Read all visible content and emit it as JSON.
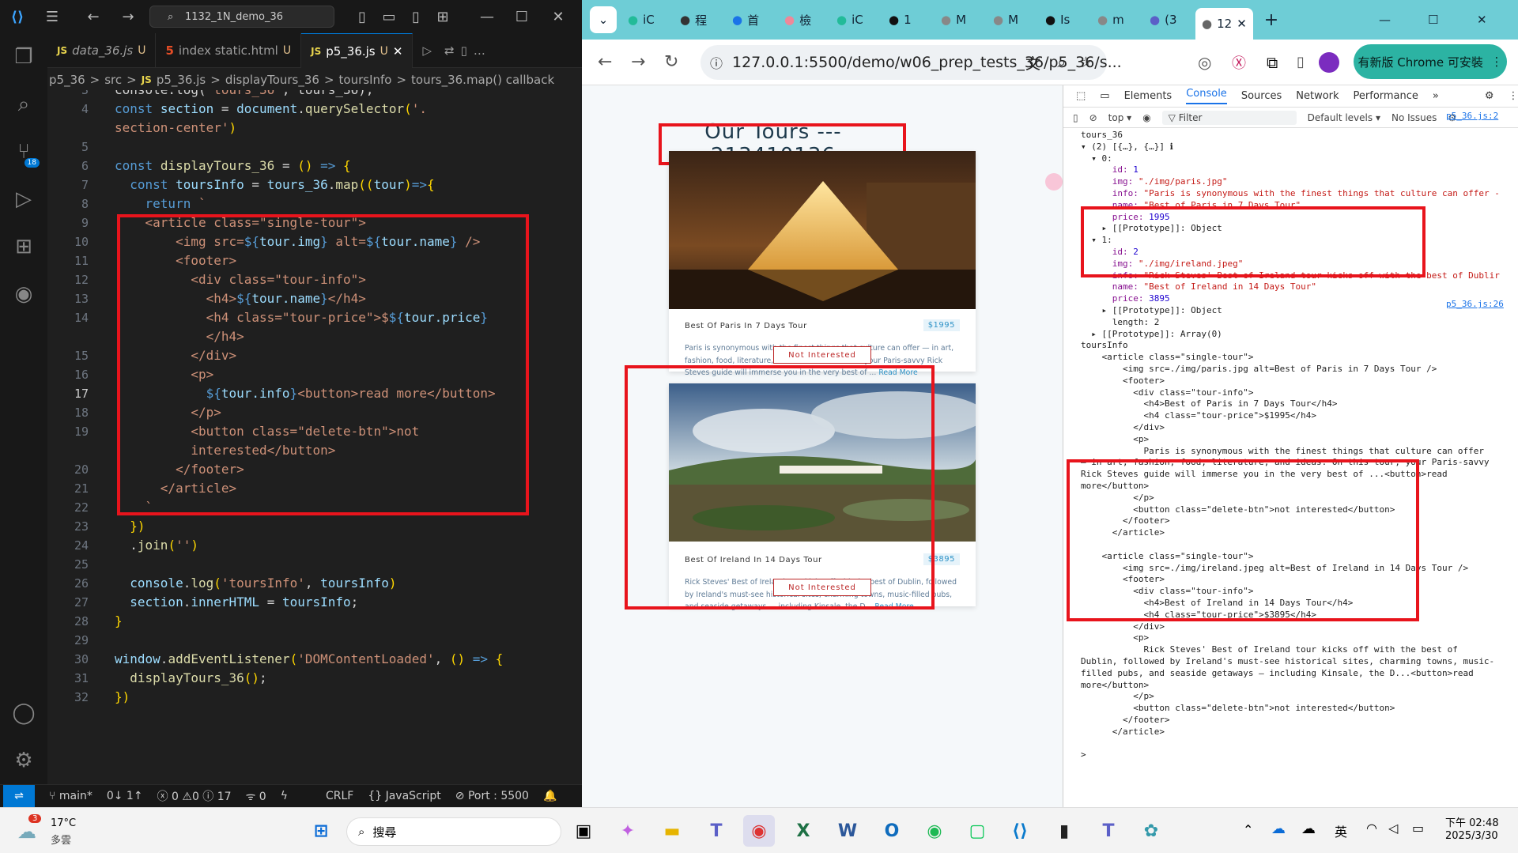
{
  "vscode": {
    "search_text": "1132_1N_demo_36",
    "tabs": [
      {
        "name": "data_36.js",
        "type": "JS",
        "status": "U"
      },
      {
        "name": "index static.html",
        "type": "HTML",
        "status": "U"
      },
      {
        "name": "p5_36.js",
        "type": "JS",
        "status": "U",
        "active": true
      }
    ],
    "breadcrumb": [
      "p5_36",
      ">",
      "src",
      ">",
      "JS",
      "p5_36.js",
      ">",
      "displayTours_36",
      ">",
      "toursInfo",
      ">",
      "tours_36.map() callback"
    ],
    "scm_badge": "18",
    "status": {
      "branch": "main*",
      "sync": "0↓ 1↑",
      "problems": "0 ⚠0 ⓘ 17",
      "ports": "0",
      "eol": "CRLF",
      "lang": "JavaScript",
      "port": "Port : 5500"
    }
  },
  "code": [
    {
      "n": "3",
      "html": "<span class='tx'>console.log(</span><span class='s'>'tours_36'</span><span class='tx'>, tours_36);</span>"
    },
    {
      "n": "4",
      "html": "<span class='k'>const</span> <span class='v'>section</span> <span class='tx'>= </span><span class='v'>document</span><span class='tx'>.</span><span class='f'>querySelector</span><span class='p'>(</span><span class='s'>'.</span>"
    },
    {
      "n": "",
      "html": "<span class='s'>section-center'</span><span class='p'>)</span>"
    },
    {
      "n": "5",
      "html": ""
    },
    {
      "n": "6",
      "html": "<span class='k'>const</span> <span class='f'>displayTours_36</span> <span class='tx'>= </span><span class='p'>()</span> <span class='k'>=&gt;</span> <span class='p'>{</span>"
    },
    {
      "n": "7",
      "html": "  <span class='k'>const</span> <span class='v'>toursInfo</span> <span class='tx'>= </span><span class='v'>tours_36</span><span class='tx'>.</span><span class='f'>map</span><span class='p'>((</span><span class='v'>tour</span><span class='p'>)</span><span class='k'>=&gt;</span><span class='p'>{</span>"
    },
    {
      "n": "8",
      "html": "    <span class='k'>return</span> <span class='s'>`</span>"
    },
    {
      "n": "9",
      "html": "    <span class='s'>&lt;article class=\"single-tour\"&gt;</span>"
    },
    {
      "n": "10",
      "html": "        <span class='s'>&lt;img src=</span><span class='k'>${</span><span class='v'>tour.img</span><span class='k'>}</span><span class='s'> alt=</span><span class='k'>${</span><span class='v'>tour.name</span><span class='k'>}</span><span class='s'> /&gt;</span>"
    },
    {
      "n": "11",
      "html": "        <span class='s'>&lt;footer&gt;</span>"
    },
    {
      "n": "12",
      "html": "          <span class='s'>&lt;div class=\"tour-info\"&gt;</span>"
    },
    {
      "n": "13",
      "html": "            <span class='s'>&lt;h4&gt;</span><span class='k'>${</span><span class='v'>tour.name</span><span class='k'>}</span><span class='s'>&lt;/h4&gt;</span>"
    },
    {
      "n": "14",
      "html": "            <span class='s'>&lt;h4 class=\"tour-price\"&gt;$</span><span class='k'>${</span><span class='v'>tour.price</span><span class='k'>}</span>"
    },
    {
      "n": "",
      "html": "            <span class='s'>&lt;/h4&gt;</span>"
    },
    {
      "n": "15",
      "html": "          <span class='s'>&lt;/div&gt;</span>"
    },
    {
      "n": "16",
      "html": "          <span class='s'>&lt;p&gt;</span>"
    },
    {
      "n": "17",
      "html": "            <span class='k'>${</span><span class='v'>tour.info</span><span class='k'>}</span><span class='s'>&lt;button&gt;read more&lt;/button&gt;</span>"
    },
    {
      "n": "18",
      "html": "          <span class='s'>&lt;/p&gt;</span>"
    },
    {
      "n": "19",
      "html": "          <span class='s'>&lt;button class=\"delete-btn\"&gt;not</span>"
    },
    {
      "n": "",
      "html": "          <span class='s'>interested&lt;/button&gt;</span>"
    },
    {
      "n": "20",
      "html": "        <span class='s'>&lt;/footer&gt;</span>"
    },
    {
      "n": "21",
      "html": "      <span class='s'>&lt;/article&gt;</span>"
    },
    {
      "n": "22",
      "html": "    <span class='s'>`</span>"
    },
    {
      "n": "23",
      "html": "  <span class='p'>})</span>"
    },
    {
      "n": "24",
      "html": "  <span class='tx'>.</span><span class='f'>join</span><span class='p'>(</span><span class='s'>''</span><span class='p'>)</span>"
    },
    {
      "n": "25",
      "html": ""
    },
    {
      "n": "26",
      "html": "  <span class='v'>console</span><span class='tx'>.</span><span class='f'>log</span><span class='p'>(</span><span class='s'>'toursInfo'</span><span class='tx'>, </span><span class='v'>toursInfo</span><span class='p'>)</span>"
    },
    {
      "n": "27",
      "html": "  <span class='v'>section</span><span class='tx'>.</span><span class='v'>innerHTML</span> <span class='tx'>= </span><span class='v'>toursInfo</span><span class='tx'>;</span>"
    },
    {
      "n": "28",
      "html": "<span class='p'>}</span>"
    },
    {
      "n": "29",
      "html": ""
    },
    {
      "n": "30",
      "html": "<span class='v'>window</span><span class='tx'>.</span><span class='f'>addEventListener</span><span class='p'>(</span><span class='s'>'DOMContentLoaded'</span><span class='tx'>, </span><span class='p'>()</span> <span class='k'>=&gt;</span> <span class='p'>{</span>"
    },
    {
      "n": "31",
      "html": "  <span class='f'>displayTours_36</span><span class='p'>()</span><span class='tx'>;</span>"
    },
    {
      "n": "32",
      "html": "<span class='p'>})</span>"
    }
  ],
  "browser": {
    "url": "127.0.0.1:5500/demo/w06_prep_tests_36/p5_36/s...",
    "update_label": "有新版 Chrome 可安裝",
    "tabs": [
      "iC",
      "程",
      "首",
      "檢",
      "iC",
      "1",
      "M",
      "M",
      "Is",
      "m",
      "(3",
      "12"
    ],
    "page_title": "Our Tours --- 213410136",
    "tours": [
      {
        "name": "Best Of Paris In 7 Days Tour",
        "price": "$1995",
        "info": "Paris is synonymous with the finest things that culture can offer — in art, fashion, food, literature, and ideas. On this tour, your Paris-savvy Rick Steves guide will immerse you in the very best of ...",
        "read_more": "Read More",
        "btn": "Not Interested"
      },
      {
        "name": "Best Of Ireland In 14 Days Tour",
        "price": "$3895",
        "info": "Rick Steves' Best of Ireland tour kicks off with the best of Dublin, followed by Ireland's must-see historical sites, charming towns, music-filled pubs, and seaside getaways — including Kinsale, the D...",
        "read_more": "Read More",
        "btn": "Not Interested"
      }
    ]
  },
  "devtools": {
    "tabs": [
      "Elements",
      "Console",
      "Sources",
      "Network",
      "Performance"
    ],
    "context": "top",
    "filter": "Filter",
    "levels": "Default levels",
    "issues": "No Issues",
    "source1": "p5_36.js:2",
    "source2": "p5_36.js:26"
  },
  "taskbar": {
    "weather_temp": "17°C",
    "weather_desc": "多雲",
    "weather_badge": "3",
    "search": "搜尋",
    "time": "下午 02:48",
    "date": "2025/3/30",
    "ime": "英"
  }
}
